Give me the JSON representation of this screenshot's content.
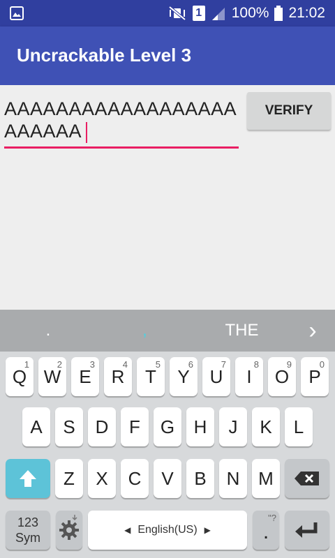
{
  "status_bar": {
    "battery": "100%",
    "time": "21:02",
    "sim": "1"
  },
  "app": {
    "title": "Uncrackable Level 3"
  },
  "form": {
    "input_value": "AAAAAAAAAAAAAAAAAAAAAAAA",
    "verify_label": "VERIFY"
  },
  "suggestions": [
    ".",
    ",",
    "THE",
    "›"
  ],
  "keyboard": {
    "row1": [
      {
        "label": "Q",
        "hint": "1"
      },
      {
        "label": "W",
        "hint": "2"
      },
      {
        "label": "E",
        "hint": "3"
      },
      {
        "label": "R",
        "hint": "4"
      },
      {
        "label": "T",
        "hint": "5"
      },
      {
        "label": "Y",
        "hint": "6"
      },
      {
        "label": "U",
        "hint": "7"
      },
      {
        "label": "I",
        "hint": "8"
      },
      {
        "label": "O",
        "hint": "9"
      },
      {
        "label": "P",
        "hint": "0"
      }
    ],
    "row2": [
      "A",
      "S",
      "D",
      "F",
      "G",
      "H",
      "J",
      "K",
      "L"
    ],
    "row3": [
      "Z",
      "X",
      "C",
      "V",
      "B",
      "N",
      "M"
    ],
    "sym_label_1": "123",
    "sym_label_2": "Sym",
    "space_label": "English(US)",
    "period_label": ".",
    "period_hint": "\"?",
    "icons": {
      "shift": "shift-arrow-icon",
      "backspace": "backspace-icon",
      "settings": "gear-icon",
      "enter": "enter-return-icon"
    }
  },
  "colors": {
    "status_bar": "#303f9f",
    "app_bar": "#3f51b5",
    "accent": "#e91e63",
    "shift_key": "#5dc3d8"
  }
}
